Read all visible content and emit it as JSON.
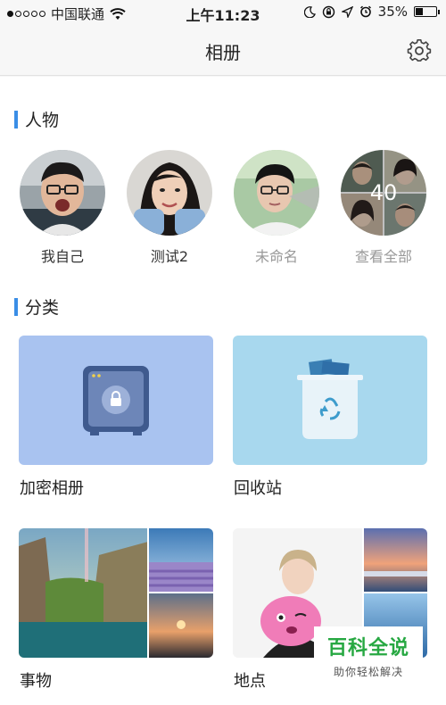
{
  "status_bar": {
    "carrier": "中国联通",
    "time": "上午11:23",
    "battery": "35%",
    "battery_level": 0.35
  },
  "nav": {
    "title": "相册"
  },
  "people_section": {
    "title": "人物",
    "people": [
      {
        "name": "我自己"
      },
      {
        "name": "测试2"
      },
      {
        "name": "未命名"
      },
      {
        "name": "查看全部",
        "count": "40"
      }
    ]
  },
  "category_section": {
    "title": "分类",
    "cards": [
      {
        "label": "加密相册"
      },
      {
        "label": "回收站"
      },
      {
        "label": "事物"
      },
      {
        "label": "地点"
      }
    ]
  },
  "watermark": {
    "main": "百科全说",
    "sub": "助你轻松解决"
  },
  "colors": {
    "accent": "#3a8ee6",
    "encrypted_card": "#a9c3f0",
    "recycle_card": "#a8d8ee",
    "watermark_green": "#27a842"
  }
}
